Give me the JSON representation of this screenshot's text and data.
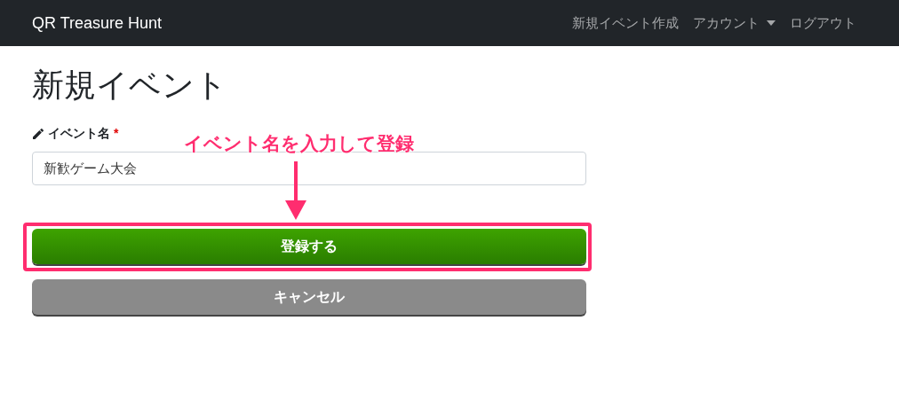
{
  "navbar": {
    "brand": "QR Treasure Hunt",
    "links": [
      {
        "label": "新規イベント作成",
        "kind": "link"
      },
      {
        "label": "アカウント",
        "kind": "dropdown"
      },
      {
        "label": "ログアウト",
        "kind": "link"
      }
    ]
  },
  "page_title": "新規イベント",
  "form": {
    "label": "イベント名",
    "required_mark": "*",
    "value": "新歓ゲーム大会",
    "buttons": [
      {
        "label": "登録する",
        "kind": "primary"
      },
      {
        "label": "キャンセル",
        "kind": "secondary"
      }
    ]
  },
  "annotation": {
    "text": "イベント名を入力して登録"
  }
}
